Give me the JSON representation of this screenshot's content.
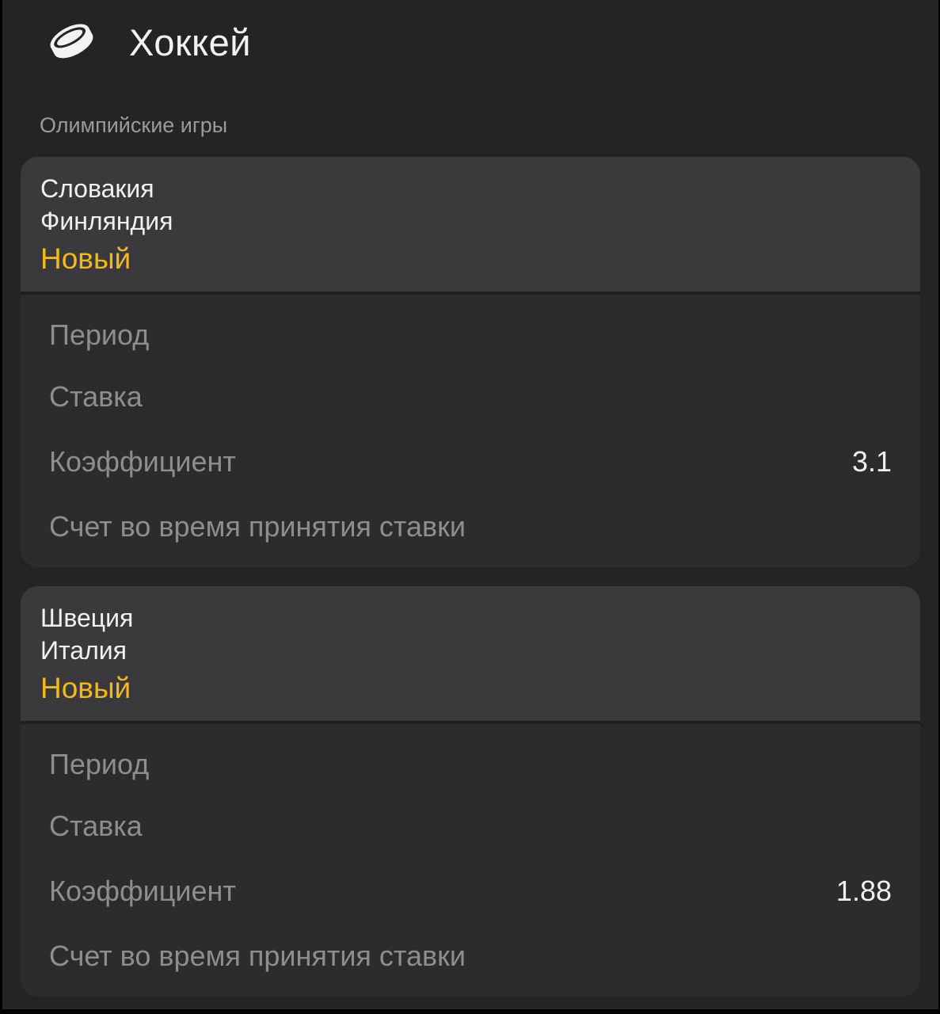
{
  "header": {
    "sport": "Хоккей",
    "icon": "hockey-puck-icon"
  },
  "league": "Олимпийские игры",
  "labels": {
    "period": "Период",
    "bet": "Ставка",
    "coefficient": "Коэффициент",
    "score_at_bet": "Счет во время принятия ставки"
  },
  "colors": {
    "status": "#f3b81f",
    "background": "#242424",
    "card": "#2c2c2e",
    "card_header": "#3a3a3c"
  },
  "bets": [
    {
      "team1": "Словакия",
      "team2": "Финляндия",
      "status": "Новый",
      "period": "",
      "bet": "",
      "coefficient": "3.1",
      "score_at_bet": ""
    },
    {
      "team1": "Швеция",
      "team2": "Италия",
      "status": "Новый",
      "period": "",
      "bet": "",
      "coefficient": "1.88",
      "score_at_bet": ""
    }
  ]
}
